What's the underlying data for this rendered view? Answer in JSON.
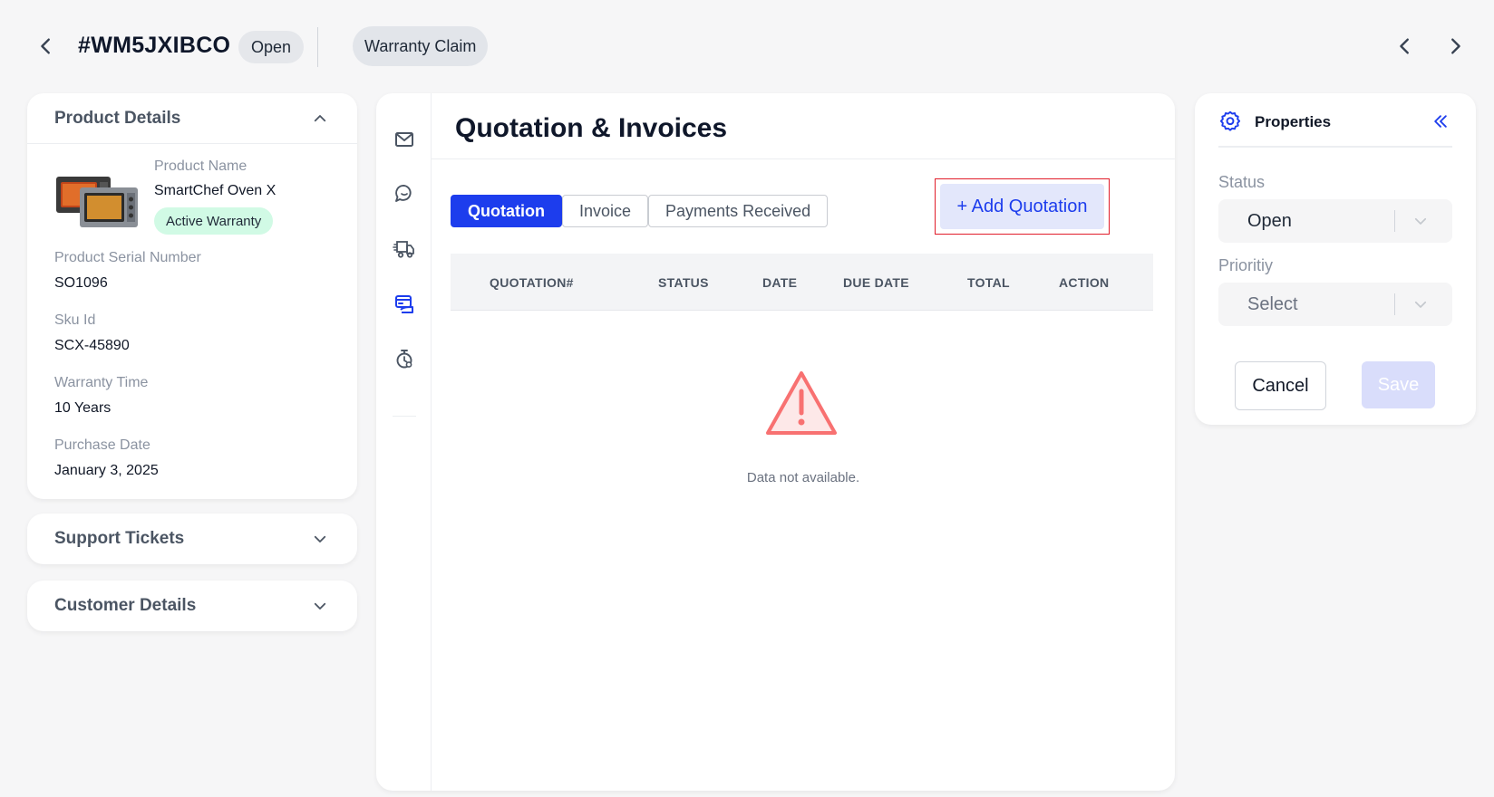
{
  "header": {
    "ticket_id": "#WM5JXIBCO",
    "status": "Open",
    "ticket_type": "Warranty Claim"
  },
  "product_details": {
    "title": "Product Details",
    "product_name_label": "Product Name",
    "product_name": "SmartChef Oven X",
    "warranty_badge": "Active Warranty",
    "serial_label": "Product Serial Number",
    "serial": "SO1096",
    "sku_label": "Sku Id",
    "sku": "SCX-45890",
    "warranty_time_label": "Warranty Time",
    "warranty_time": "10 Years",
    "purchase_date_label": "Purchase Date",
    "purchase_date": "January 3, 2025"
  },
  "support_tickets": {
    "title": "Support Tickets"
  },
  "customer_details": {
    "title": "Customer Details"
  },
  "main": {
    "title": "Quotation & Invoices",
    "tabs": [
      {
        "label": "Quotation",
        "active": true
      },
      {
        "label": "Invoice",
        "active": false
      },
      {
        "label": "Payments Received",
        "active": false
      }
    ],
    "add_button": "+ Add Quotation",
    "columns": [
      "QUOTATION#",
      "STATUS",
      "DATE",
      "DUE DATE",
      "TOTAL",
      "ACTION"
    ],
    "empty_text": "Data not available."
  },
  "properties": {
    "title": "Properties",
    "status_label": "Status",
    "status_value": "Open",
    "priority_label": "Prioritiy",
    "priority_value": "Select",
    "cancel_label": "Cancel",
    "save_label": "Save"
  },
  "colors": {
    "primary": "#1d3ded",
    "badge_green": "#d1fae5",
    "highlight_red": "#e11d2a",
    "warning_icon": "#f87171"
  },
  "icons": [
    "chevron-left-icon",
    "chevron-right-icon",
    "chevron-up-icon",
    "chevron-down-icon",
    "mail-icon",
    "chat-icon",
    "delivery-truck-icon",
    "payment-icon",
    "timer-icon",
    "warning-triangle-icon",
    "gear-icon",
    "double-chevron-left-icon"
  ]
}
